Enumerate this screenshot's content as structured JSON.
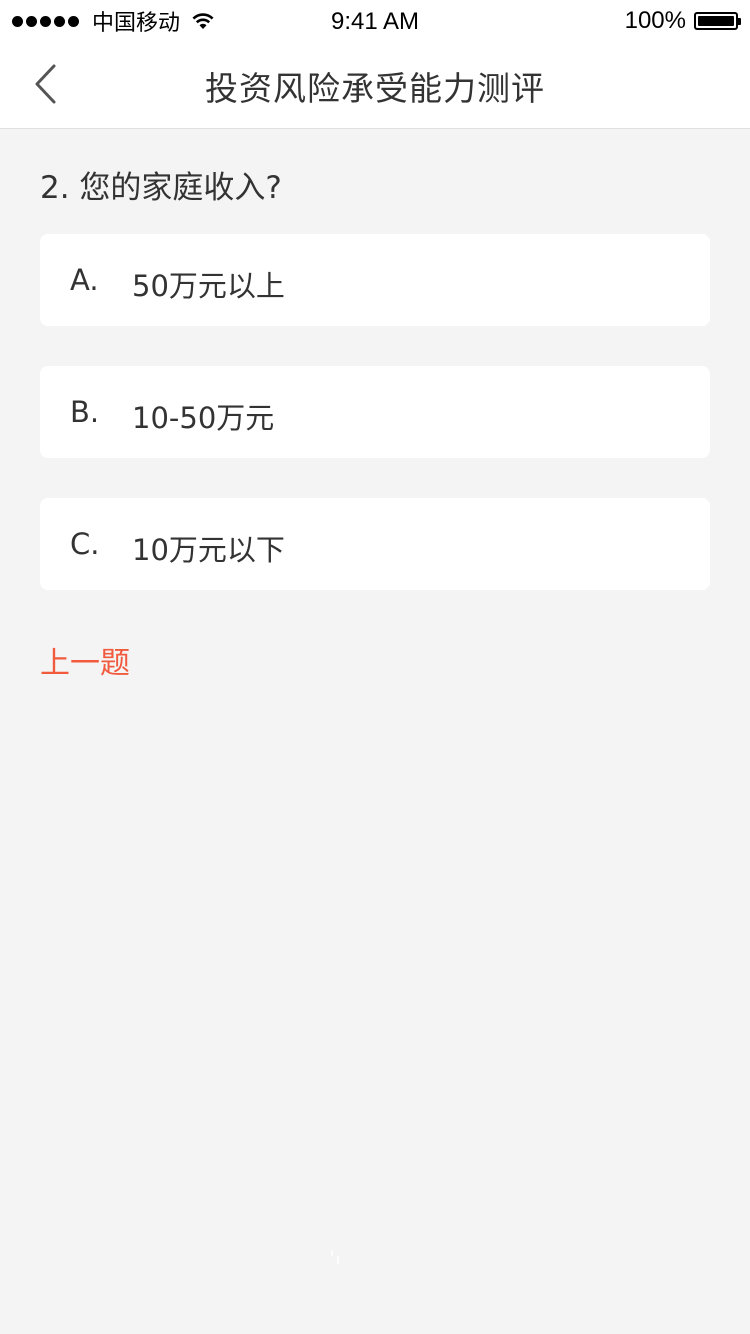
{
  "status_bar": {
    "carrier": "中国移动",
    "time": "9:41 AM",
    "battery": "100%"
  },
  "nav": {
    "title": "投资风险承受能力测评",
    "back_icon": "chevron-left-icon"
  },
  "question": {
    "title": "2. 您的家庭收入?",
    "options": [
      {
        "letter": "A.",
        "text": "50万元以上"
      },
      {
        "letter": "B.",
        "text": "10-50万元"
      },
      {
        "letter": "C.",
        "text": "10万元以下"
      }
    ]
  },
  "actions": {
    "prev_label": "上一题"
  },
  "colors": {
    "accent": "#f25a3e",
    "background": "#f4f4f4",
    "card": "#ffffff",
    "text": "#333333"
  }
}
